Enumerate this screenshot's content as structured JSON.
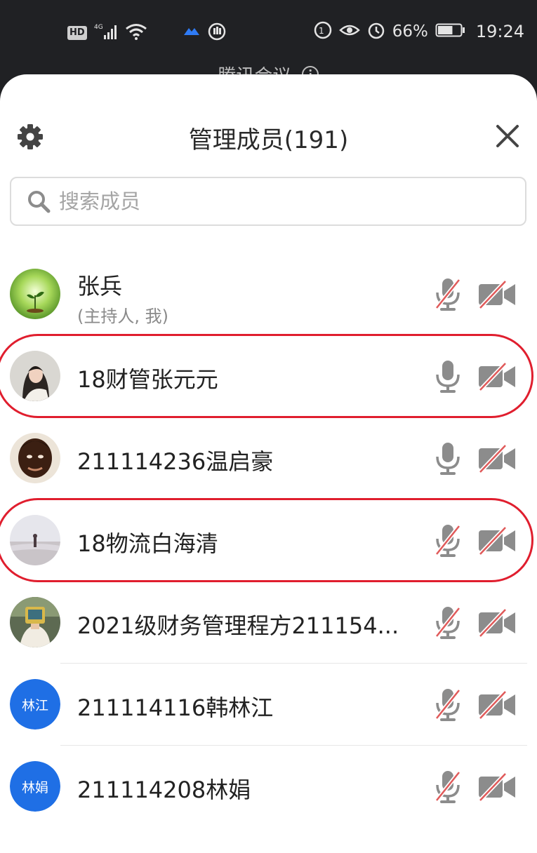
{
  "status_bar": {
    "hd_badge": "HD",
    "network_type": "4G",
    "battery_percent": "66%",
    "time": "19:24",
    "icons": [
      "signal-icon",
      "wifi-icon",
      "app-notification-icon",
      "hand-icon",
      "data-saver-icon",
      "eye-icon",
      "alarm-icon",
      "battery-icon"
    ],
    "battery_level": 0.66
  },
  "background_title": "腾讯会议",
  "panel": {
    "title": "管理成员(191)",
    "search_placeholder": "搜索成员",
    "icons": {
      "settings": "gear-icon",
      "close": "close-icon",
      "search": "search-icon"
    }
  },
  "members": [
    {
      "name": "张兵",
      "subtitle": "(主持人, 我)",
      "avatar_kind": "photo-sprout",
      "mic_muted": true,
      "camera_off": true,
      "highlighted": false
    },
    {
      "name": "18财管张元元",
      "avatar_kind": "photo-girl",
      "mic_muted": false,
      "camera_off": true,
      "highlighted": true
    },
    {
      "name": "211114236温启豪",
      "avatar_kind": "photo-man",
      "mic_muted": false,
      "camera_off": true,
      "highlighted": false
    },
    {
      "name": "18物流白海清",
      "avatar_kind": "photo-beach",
      "mic_muted": true,
      "camera_off": true,
      "highlighted": true
    },
    {
      "name": "2021级财务管理程方211154...",
      "avatar_kind": "photo-boy",
      "mic_muted": true,
      "camera_off": true,
      "highlighted": false
    },
    {
      "name": "211114116韩林江",
      "avatar_text": "林江",
      "mic_muted": true,
      "camera_off": true,
      "highlighted": false
    },
    {
      "name": "211114208林娟",
      "avatar_text": "林娟",
      "mic_muted": true,
      "camera_off": true,
      "highlighted": false
    }
  ],
  "colors": {
    "status_bar_bg": "#202124",
    "avatar_blue": "#1f6fe5",
    "muted_slash": "#e05a5a",
    "highlight_ring": "#e01e2e",
    "icon_gray": "#8c8c8c"
  }
}
